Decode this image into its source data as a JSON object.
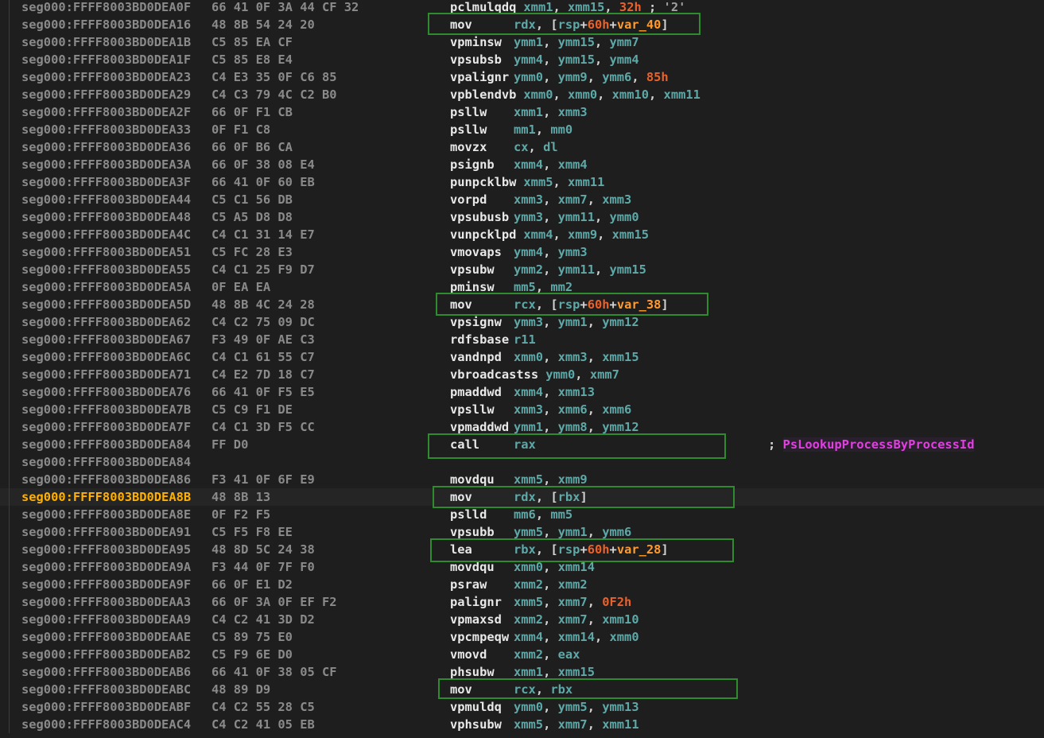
{
  "rows": [
    {
      "addr": "seg000:FFFF8003BD0DEA0F",
      "bytes": "66 41 0F 3A 44 CF 32",
      "m": "pclmulqdq",
      "ops": [
        [
          "xmm1",
          "op"
        ],
        [
          ", ",
          "pl"
        ],
        [
          "xmm15",
          "op"
        ],
        [
          ", ",
          "pl"
        ],
        [
          "32h",
          "num"
        ],
        [
          " ; ",
          "pl"
        ],
        [
          "'2'",
          "str"
        ]
      ]
    },
    {
      "addr": "seg000:FFFF8003BD0DEA16",
      "bytes": "48 8B 54 24 20",
      "m": "mov",
      "ops": [
        [
          "rdx",
          "op"
        ],
        [
          ", [",
          "pl"
        ],
        [
          "rsp",
          "op"
        ],
        [
          "+",
          "pl"
        ],
        [
          "60h",
          "num"
        ],
        [
          "+",
          "pl"
        ],
        [
          "var_40",
          "var"
        ],
        [
          "]",
          "pl"
        ]
      ]
    },
    {
      "addr": "seg000:FFFF8003BD0DEA1B",
      "bytes": "C5 85 EA CF",
      "m": "vpminsw",
      "ops": [
        [
          "ymm1",
          "op"
        ],
        [
          ", ",
          "pl"
        ],
        [
          "ymm15",
          "op"
        ],
        [
          ", ",
          "pl"
        ],
        [
          "ymm7",
          "op"
        ]
      ]
    },
    {
      "addr": "seg000:FFFF8003BD0DEA1F",
      "bytes": "C5 85 E8 E4",
      "m": "vpsubsb",
      "ops": [
        [
          "ymm4",
          "op"
        ],
        [
          ", ",
          "pl"
        ],
        [
          "ymm15",
          "op"
        ],
        [
          ", ",
          "pl"
        ],
        [
          "ymm4",
          "op"
        ]
      ]
    },
    {
      "addr": "seg000:FFFF8003BD0DEA23",
      "bytes": "C4 E3 35 0F C6 85",
      "m": "vpalignr",
      "ops": [
        [
          "ymm0",
          "op"
        ],
        [
          ", ",
          "pl"
        ],
        [
          "ymm9",
          "op"
        ],
        [
          ", ",
          "pl"
        ],
        [
          "ymm6",
          "op"
        ],
        [
          ", ",
          "pl"
        ],
        [
          "85h",
          "num"
        ]
      ]
    },
    {
      "addr": "seg000:FFFF8003BD0DEA29",
      "bytes": "C4 C3 79 4C C2 B0",
      "m": "vpblendvb",
      "ops": [
        [
          "xmm0",
          "op"
        ],
        [
          ", ",
          "pl"
        ],
        [
          "xmm0",
          "op"
        ],
        [
          ", ",
          "pl"
        ],
        [
          "xmm10",
          "op"
        ],
        [
          ", ",
          "pl"
        ],
        [
          "xmm11",
          "op"
        ]
      ]
    },
    {
      "addr": "seg000:FFFF8003BD0DEA2F",
      "bytes": "66 0F F1 CB",
      "m": "psllw",
      "ops": [
        [
          "xmm1",
          "op"
        ],
        [
          ", ",
          "pl"
        ],
        [
          "xmm3",
          "op"
        ]
      ]
    },
    {
      "addr": "seg000:FFFF8003BD0DEA33",
      "bytes": "0F F1 C8",
      "m": "psllw",
      "ops": [
        [
          "mm1",
          "op"
        ],
        [
          ", ",
          "pl"
        ],
        [
          "mm0",
          "op"
        ]
      ]
    },
    {
      "addr": "seg000:FFFF8003BD0DEA36",
      "bytes": "66 0F B6 CA",
      "m": "movzx",
      "ops": [
        [
          "cx",
          "op"
        ],
        [
          ", ",
          "pl"
        ],
        [
          "dl",
          "op"
        ]
      ]
    },
    {
      "addr": "seg000:FFFF8003BD0DEA3A",
      "bytes": "66 0F 38 08 E4",
      "m": "psignb",
      "ops": [
        [
          "xmm4",
          "op"
        ],
        [
          ", ",
          "pl"
        ],
        [
          "xmm4",
          "op"
        ]
      ]
    },
    {
      "addr": "seg000:FFFF8003BD0DEA3F",
      "bytes": "66 41 0F 60 EB",
      "m": "punpcklbw",
      "ops": [
        [
          "xmm5",
          "op"
        ],
        [
          ", ",
          "pl"
        ],
        [
          "xmm11",
          "op"
        ]
      ]
    },
    {
      "addr": "seg000:FFFF8003BD0DEA44",
      "bytes": "C5 C1 56 DB",
      "m": "vorpd",
      "ops": [
        [
          "xmm3",
          "op"
        ],
        [
          ", ",
          "pl"
        ],
        [
          "xmm7",
          "op"
        ],
        [
          ", ",
          "pl"
        ],
        [
          "xmm3",
          "op"
        ]
      ]
    },
    {
      "addr": "seg000:FFFF8003BD0DEA48",
      "bytes": "C5 A5 D8 D8",
      "m": "vpsubusb",
      "ops": [
        [
          "ymm3",
          "op"
        ],
        [
          ", ",
          "pl"
        ],
        [
          "ymm11",
          "op"
        ],
        [
          ", ",
          "pl"
        ],
        [
          "ymm0",
          "op"
        ]
      ]
    },
    {
      "addr": "seg000:FFFF8003BD0DEA4C",
      "bytes": "C4 C1 31 14 E7",
      "m": "vunpcklpd",
      "ops": [
        [
          "xmm4",
          "op"
        ],
        [
          ", ",
          "pl"
        ],
        [
          "xmm9",
          "op"
        ],
        [
          ", ",
          "pl"
        ],
        [
          "xmm15",
          "op"
        ]
      ]
    },
    {
      "addr": "seg000:FFFF8003BD0DEA51",
      "bytes": "C5 FC 28 E3",
      "m": "vmovaps",
      "ops": [
        [
          "ymm4",
          "op"
        ],
        [
          ", ",
          "pl"
        ],
        [
          "ymm3",
          "op"
        ]
      ]
    },
    {
      "addr": "seg000:FFFF8003BD0DEA55",
      "bytes": "C4 C1 25 F9 D7",
      "m": "vpsubw",
      "ops": [
        [
          "ymm2",
          "op"
        ],
        [
          ", ",
          "pl"
        ],
        [
          "ymm11",
          "op"
        ],
        [
          ", ",
          "pl"
        ],
        [
          "ymm15",
          "op"
        ]
      ]
    },
    {
      "addr": "seg000:FFFF8003BD0DEA5A",
      "bytes": "0F EA EA",
      "m": "pminsw",
      "ops": [
        [
          "mm5",
          "op"
        ],
        [
          ", ",
          "pl"
        ],
        [
          "mm2",
          "op"
        ]
      ]
    },
    {
      "addr": "seg000:FFFF8003BD0DEA5D",
      "bytes": "48 8B 4C 24 28",
      "m": "mov",
      "ops": [
        [
          "rcx",
          "op"
        ],
        [
          ", [",
          "pl"
        ],
        [
          "rsp",
          "op"
        ],
        [
          "+",
          "pl"
        ],
        [
          "60h",
          "num"
        ],
        [
          "+",
          "pl"
        ],
        [
          "var_38",
          "var"
        ],
        [
          "]",
          "pl"
        ]
      ]
    },
    {
      "addr": "seg000:FFFF8003BD0DEA62",
      "bytes": "C4 C2 75 09 DC",
      "m": "vpsignw",
      "ops": [
        [
          "ymm3",
          "op"
        ],
        [
          ", ",
          "pl"
        ],
        [
          "ymm1",
          "op"
        ],
        [
          ", ",
          "pl"
        ],
        [
          "ymm12",
          "op"
        ]
      ]
    },
    {
      "addr": "seg000:FFFF8003BD0DEA67",
      "bytes": "F3 49 0F AE C3",
      "m": "rdfsbase",
      "ops": [
        [
          "r11",
          "op"
        ]
      ]
    },
    {
      "addr": "seg000:FFFF8003BD0DEA6C",
      "bytes": "C4 C1 61 55 C7",
      "m": "vandnpd",
      "ops": [
        [
          "xmm0",
          "op"
        ],
        [
          ", ",
          "pl"
        ],
        [
          "xmm3",
          "op"
        ],
        [
          ", ",
          "pl"
        ],
        [
          "xmm15",
          "op"
        ]
      ]
    },
    {
      "addr": "seg000:FFFF8003BD0DEA71",
      "bytes": "C4 E2 7D 18 C7",
      "m": "vbroadcastss",
      "ops": [
        [
          "ymm0",
          "op"
        ],
        [
          ", ",
          "pl"
        ],
        [
          "xmm7",
          "op"
        ]
      ]
    },
    {
      "addr": "seg000:FFFF8003BD0DEA76",
      "bytes": "66 41 0F F5 E5",
      "m": "pmaddwd",
      "ops": [
        [
          "xmm4",
          "op"
        ],
        [
          ", ",
          "pl"
        ],
        [
          "xmm13",
          "op"
        ]
      ]
    },
    {
      "addr": "seg000:FFFF8003BD0DEA7B",
      "bytes": "C5 C9 F1 DE",
      "m": "vpsllw",
      "ops": [
        [
          "xmm3",
          "op"
        ],
        [
          ", ",
          "pl"
        ],
        [
          "xmm6",
          "op"
        ],
        [
          ", ",
          "pl"
        ],
        [
          "xmm6",
          "op"
        ]
      ]
    },
    {
      "addr": "seg000:FFFF8003BD0DEA7F",
      "bytes": "C4 C1 3D F5 CC",
      "m": "vpmaddwd",
      "ops": [
        [
          "ymm1",
          "op"
        ],
        [
          ", ",
          "pl"
        ],
        [
          "ymm8",
          "op"
        ],
        [
          ", ",
          "pl"
        ],
        [
          "ymm12",
          "op"
        ]
      ]
    },
    {
      "addr": "seg000:FFFF8003BD0DEA84",
      "bytes": "FF D0",
      "m": "call",
      "ops": [
        [
          "rax",
          "op"
        ]
      ],
      "cmt": "; ",
      "fn": "PsLookupProcessByProcessId"
    },
    {
      "addr": "seg000:FFFF8003BD0DEA84",
      "bytes": "",
      "m": "",
      "ops": []
    },
    {
      "addr": "seg000:FFFF8003BD0DEA86",
      "bytes": "F3 41 0F 6F E9",
      "m": "movdqu",
      "ops": [
        [
          "xmm5",
          "op"
        ],
        [
          ", ",
          "pl"
        ],
        [
          "xmm9",
          "op"
        ]
      ]
    },
    {
      "addr": "seg000:FFFF8003BD0DEA8B",
      "bytes": "48 8B 13",
      "m": "mov",
      "ops": [
        [
          "rdx",
          "op"
        ],
        [
          ", [",
          "pl"
        ],
        [
          "rbx",
          "op"
        ],
        [
          "]",
          "pl"
        ]
      ],
      "current": true
    },
    {
      "addr": "seg000:FFFF8003BD0DEA8E",
      "bytes": "0F F2 F5",
      "m": "pslld",
      "ops": [
        [
          "mm6",
          "op"
        ],
        [
          ", ",
          "pl"
        ],
        [
          "mm5",
          "op"
        ]
      ]
    },
    {
      "addr": "seg000:FFFF8003BD0DEA91",
      "bytes": "C5 F5 F8 EE",
      "m": "vpsubb",
      "ops": [
        [
          "ymm5",
          "op"
        ],
        [
          ", ",
          "pl"
        ],
        [
          "ymm1",
          "op"
        ],
        [
          ", ",
          "pl"
        ],
        [
          "ymm6",
          "op"
        ]
      ]
    },
    {
      "addr": "seg000:FFFF8003BD0DEA95",
      "bytes": "48 8D 5C 24 38",
      "m": "lea",
      "ops": [
        [
          "rbx",
          "op"
        ],
        [
          ", [",
          "pl"
        ],
        [
          "rsp",
          "op"
        ],
        [
          "+",
          "pl"
        ],
        [
          "60h",
          "num"
        ],
        [
          "+",
          "pl"
        ],
        [
          "var_28",
          "var"
        ],
        [
          "]",
          "pl"
        ]
      ]
    },
    {
      "addr": "seg000:FFFF8003BD0DEA9A",
      "bytes": "F3 44 0F 7F F0",
      "m": "movdqu",
      "ops": [
        [
          "xmm0",
          "op"
        ],
        [
          ", ",
          "pl"
        ],
        [
          "xmm14",
          "op"
        ]
      ]
    },
    {
      "addr": "seg000:FFFF8003BD0DEA9F",
      "bytes": "66 0F E1 D2",
      "m": "psraw",
      "ops": [
        [
          "xmm2",
          "op"
        ],
        [
          ", ",
          "pl"
        ],
        [
          "xmm2",
          "op"
        ]
      ]
    },
    {
      "addr": "seg000:FFFF8003BD0DEAA3",
      "bytes": "66 0F 3A 0F EF F2",
      "m": "palignr",
      "ops": [
        [
          "xmm5",
          "op"
        ],
        [
          ", ",
          "pl"
        ],
        [
          "xmm7",
          "op"
        ],
        [
          ", ",
          "pl"
        ],
        [
          "0F2h",
          "num"
        ]
      ]
    },
    {
      "addr": "seg000:FFFF8003BD0DEAA9",
      "bytes": "C4 C2 41 3D D2",
      "m": "vpmaxsd",
      "ops": [
        [
          "xmm2",
          "op"
        ],
        [
          ", ",
          "pl"
        ],
        [
          "xmm7",
          "op"
        ],
        [
          ", ",
          "pl"
        ],
        [
          "xmm10",
          "op"
        ]
      ]
    },
    {
      "addr": "seg000:FFFF8003BD0DEAAE",
      "bytes": "C5 89 75 E0",
      "m": "vpcmpeqw",
      "ops": [
        [
          "xmm4",
          "op"
        ],
        [
          ", ",
          "pl"
        ],
        [
          "xmm14",
          "op"
        ],
        [
          ", ",
          "pl"
        ],
        [
          "xmm0",
          "op"
        ]
      ]
    },
    {
      "addr": "seg000:FFFF8003BD0DEAB2",
      "bytes": "C5 F9 6E D0",
      "m": "vmovd",
      "ops": [
        [
          "xmm2",
          "op"
        ],
        [
          ", ",
          "pl"
        ],
        [
          "eax",
          "op"
        ]
      ]
    },
    {
      "addr": "seg000:FFFF8003BD0DEAB6",
      "bytes": "66 41 0F 38 05 CF",
      "m": "phsubw",
      "ops": [
        [
          "xmm1",
          "op"
        ],
        [
          ", ",
          "pl"
        ],
        [
          "xmm15",
          "op"
        ]
      ]
    },
    {
      "addr": "seg000:FFFF8003BD0DEABC",
      "bytes": "48 89 D9",
      "m": "mov",
      "ops": [
        [
          "rcx",
          "op"
        ],
        [
          ", ",
          "pl"
        ],
        [
          "rbx",
          "op"
        ]
      ]
    },
    {
      "addr": "seg000:FFFF8003BD0DEABF",
      "bytes": "C4 C2 55 28 C5",
      "m": "vpmuldq",
      "ops": [
        [
          "ymm0",
          "op"
        ],
        [
          ", ",
          "pl"
        ],
        [
          "ymm5",
          "op"
        ],
        [
          ", ",
          "pl"
        ],
        [
          "ymm13",
          "op"
        ]
      ]
    },
    {
      "addr": "seg000:FFFF8003BD0DEAC4",
      "bytes": "C4 C2 41 05 EB",
      "m": "vphsubw",
      "ops": [
        [
          "xmm5",
          "op"
        ],
        [
          ", ",
          "pl"
        ],
        [
          "xmm7",
          "op"
        ],
        [
          ", ",
          "pl"
        ],
        [
          "xmm11",
          "op"
        ]
      ]
    }
  ]
}
